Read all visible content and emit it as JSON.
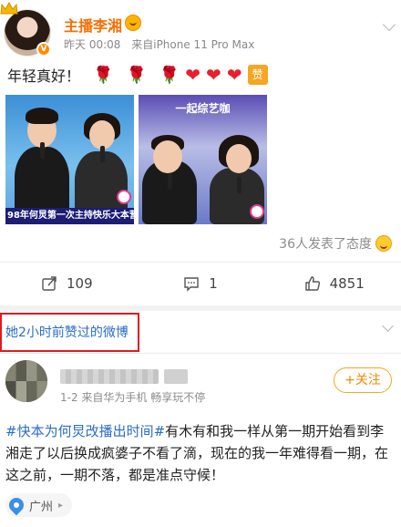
{
  "post1": {
    "username": "主播李湘",
    "time": "昨天 00:08",
    "source": "来自iPhone 11 Pro Max",
    "text": "年轻真好！",
    "emoji_zan": "赞",
    "images": [
      {
        "caption": "98年何炅第一次主持快乐大本营"
      },
      {
        "title": "一起综艺咖"
      }
    ],
    "reactions": "36人发表了态度",
    "actions": {
      "repost": "109",
      "comment": "1",
      "like": "4851"
    }
  },
  "liked_section": {
    "label": "她2小时前赞过的微博"
  },
  "post2": {
    "meta": "1-2  来自华为手机 畅享玩不停",
    "follow_label": "+关注",
    "topic": "#快本为何炅改播出时间#",
    "text": "有木有和我一样从第一期开始看到李湘走了以后换成疯婆子不看了滴，现在的我一年难得看一期，在这之前，一期不落，都是准点守候！",
    "location": "广州"
  },
  "colors": {
    "username_orange": "#f86f03",
    "link_blue": "#2a6dc8",
    "highlight_red": "#e2181d",
    "follow_orange": "#f08c00"
  }
}
